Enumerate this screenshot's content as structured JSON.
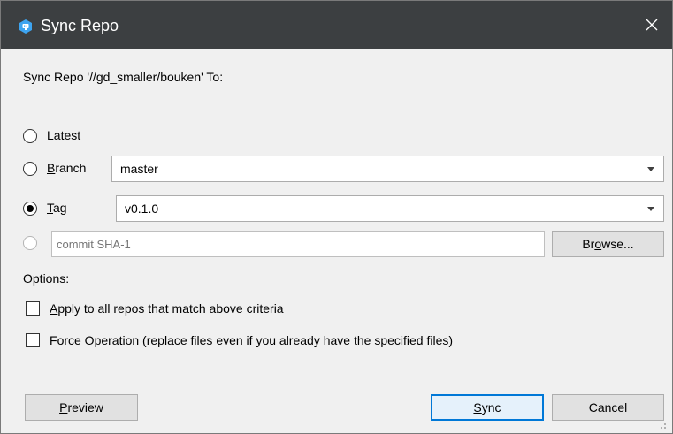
{
  "window": {
    "title": "Sync Repo",
    "close_glyph": "✕",
    "icon": "app-icon"
  },
  "dialog": {
    "header": "Sync Repo '//gd_smaller/bouken' To:",
    "options_label": "Options:"
  },
  "radios": {
    "latest": {
      "pre": "",
      "u": "L",
      "post": "atest",
      "selected": false
    },
    "branch": {
      "pre": "",
      "u": "B",
      "post": "ranch",
      "selected": false
    },
    "tag": {
      "pre": "",
      "u": "T",
      "post": "ag",
      "selected": true
    },
    "commit": {
      "selected": false,
      "enabled": false
    }
  },
  "branch_select": {
    "value": "master"
  },
  "tag_select": {
    "value": "v0.1.0"
  },
  "commit_input": {
    "placeholder": "commit SHA-1",
    "value": ""
  },
  "browse_button": {
    "pre": "Br",
    "u": "o",
    "post": "wse..."
  },
  "checkboxes": {
    "apply_all": {
      "pre": "",
      "u": "A",
      "post": "pply to all repos that match above criteria",
      "checked": false
    },
    "force": {
      "pre": "",
      "u": "F",
      "post": "orce Operation (replace files even if you already have the specified files)",
      "checked": false
    }
  },
  "buttons": {
    "preview": {
      "pre": "",
      "u": "P",
      "post": "review"
    },
    "sync": {
      "pre": "",
      "u": "S",
      "post": "ync"
    },
    "cancel": {
      "label": "Cancel"
    }
  },
  "colors": {
    "titlebar": "#3c3f41",
    "dialog_bg": "#f0f0f0",
    "accent": "#0078d7"
  }
}
